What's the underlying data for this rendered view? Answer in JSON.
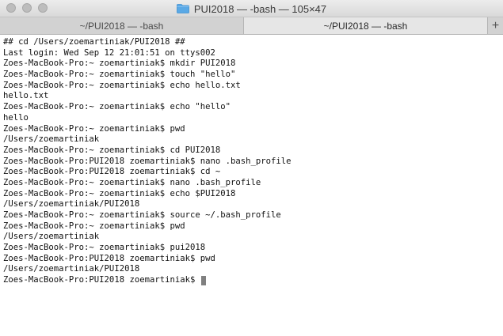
{
  "window": {
    "title": "PUI2018 — -bash — 105×47",
    "folder_icon": "folder-icon",
    "controls": [
      "close",
      "minimize",
      "zoom"
    ]
  },
  "tabs": [
    {
      "label": "~/PUI2018 — -bash",
      "active": false
    },
    {
      "label": "~/PUI2018 — -bash",
      "active": true
    }
  ],
  "tab_add_label": "+",
  "terminal": {
    "lines": [
      "## cd /Users/zoemartiniak/PUI2018 ##",
      "Last login: Wed Sep 12 21:01:51 on ttys002",
      "Zoes-MacBook-Pro:~ zoemartiniak$ mkdir PUI2018",
      "Zoes-MacBook-Pro:~ zoemartiniak$ touch \"hello\"",
      "Zoes-MacBook-Pro:~ zoemartiniak$ echo hello.txt",
      "hello.txt",
      "Zoes-MacBook-Pro:~ zoemartiniak$ echo \"hello\"",
      "hello",
      "Zoes-MacBook-Pro:~ zoemartiniak$ pwd",
      "/Users/zoemartiniak",
      "Zoes-MacBook-Pro:~ zoemartiniak$ cd PUI2018",
      "Zoes-MacBook-Pro:PUI2018 zoemartiniak$ nano .bash_profile",
      "Zoes-MacBook-Pro:PUI2018 zoemartiniak$ cd ~",
      "Zoes-MacBook-Pro:~ zoemartiniak$ nano .bash_profile",
      "Zoes-MacBook-Pro:~ zoemartiniak$ echo $PUI2018",
      "/Users/zoemartiniak/PUI2018",
      "Zoes-MacBook-Pro:~ zoemartiniak$ source ~/.bash_profile",
      "Zoes-MacBook-Pro:~ zoemartiniak$ pwd",
      "/Users/zoemartiniak",
      "Zoes-MacBook-Pro:~ zoemartiniak$ pui2018",
      "Zoes-MacBook-Pro:PUI2018 zoemartiniak$ pwd",
      "/Users/zoemartiniak/PUI2018"
    ],
    "current_prompt": "Zoes-MacBook-Pro:PUI2018 zoemartiniak$ "
  },
  "colors": {
    "folder": "#5aa9e6",
    "cursor": "#808080",
    "text": "#111111"
  }
}
